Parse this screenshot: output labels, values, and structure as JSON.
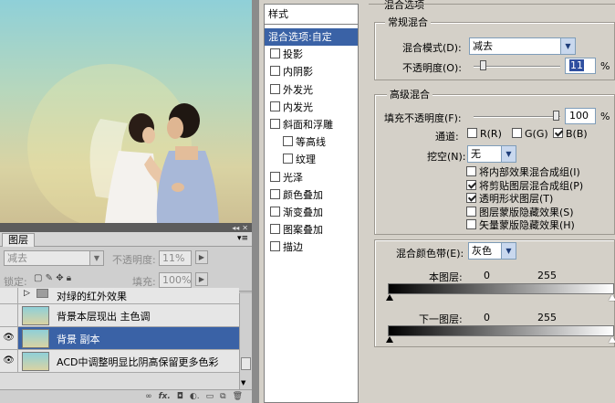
{
  "layers_panel": {
    "tab": "图层",
    "blend_mode": "减去",
    "opacity_label": "不透明度:",
    "opacity_value": "11%",
    "lock_label": "锁定:",
    "fill_label": "填充:",
    "fill_value": "100%",
    "layers": [
      {
        "name": "对绿的红外效果",
        "visible": false,
        "selected": false,
        "is_group": true
      },
      {
        "name": "背景本层现出 主色调",
        "visible": false,
        "selected": false,
        "is_group": false
      },
      {
        "name": "背景 副本",
        "visible": true,
        "selected": true,
        "is_group": false
      },
      {
        "name": "ACD中调整明显比阴高保留更多色彩",
        "visible": true,
        "selected": false,
        "is_group": false
      }
    ]
  },
  "dialog": {
    "styles_header": "样式",
    "style_items": [
      {
        "label": "混合选项:自定",
        "checkbox": false,
        "checked": false,
        "selected": true,
        "indent": false
      },
      {
        "label": "投影",
        "checkbox": true,
        "checked": false,
        "selected": false,
        "indent": false
      },
      {
        "label": "内阴影",
        "checkbox": true,
        "checked": false,
        "selected": false,
        "indent": false
      },
      {
        "label": "外发光",
        "checkbox": true,
        "checked": false,
        "selected": false,
        "indent": false
      },
      {
        "label": "内发光",
        "checkbox": true,
        "checked": false,
        "selected": false,
        "indent": false
      },
      {
        "label": "斜面和浮雕",
        "checkbox": true,
        "checked": false,
        "selected": false,
        "indent": false
      },
      {
        "label": "等高线",
        "checkbox": true,
        "checked": false,
        "selected": false,
        "indent": true
      },
      {
        "label": "纹理",
        "checkbox": true,
        "checked": false,
        "selected": false,
        "indent": true
      },
      {
        "label": "光泽",
        "checkbox": true,
        "checked": false,
        "selected": false,
        "indent": false
      },
      {
        "label": "颜色叠加",
        "checkbox": true,
        "checked": false,
        "selected": false,
        "indent": false
      },
      {
        "label": "渐变叠加",
        "checkbox": true,
        "checked": false,
        "selected": false,
        "indent": false
      },
      {
        "label": "图案叠加",
        "checkbox": true,
        "checked": false,
        "selected": false,
        "indent": false
      },
      {
        "label": "描边",
        "checkbox": true,
        "checked": false,
        "selected": false,
        "indent": false
      }
    ],
    "blend_options_title": "混合选项",
    "general": {
      "title": "常规混合",
      "mode_label": "混合模式(D):",
      "mode_value": "减去",
      "opacity_label": "不透明度(O):",
      "opacity_value": "11",
      "opacity_unit": "%",
      "opacity_fraction": 0.11
    },
    "advanced": {
      "title": "高级混合",
      "fill_label": "填充不透明度(F):",
      "fill_value": "100",
      "fill_unit": "%",
      "fill_fraction": 1.0,
      "channels_label": "通道:",
      "channel_r": "R(R)",
      "channel_g": "G(G)",
      "channel_b": "B(B)",
      "channel_r_checked": false,
      "channel_g_checked": false,
      "channel_b_checked": true,
      "knockout_label": "挖空(N):",
      "knockout_value": "无",
      "options": [
        {
          "label": "将内部效果混合成组(I)",
          "checked": false
        },
        {
          "label": "将剪贴图层混合成组(P)",
          "checked": true
        },
        {
          "label": "透明形状图层(T)",
          "checked": true
        },
        {
          "label": "图层蒙版隐藏效果(S)",
          "checked": false
        },
        {
          "label": "矢量蒙版隐藏效果(H)",
          "checked": false
        }
      ]
    },
    "blend_if": {
      "label": "混合颜色带(E):",
      "value": "灰色",
      "this_layer_label": "本图层:",
      "this_layer_low": "0",
      "this_layer_high": "255",
      "underlying_label": "下一图层:",
      "underlying_low": "0",
      "underlying_high": "255"
    }
  }
}
